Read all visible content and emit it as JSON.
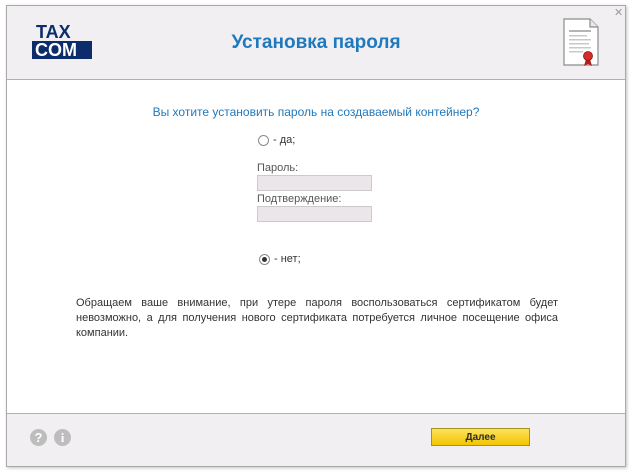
{
  "header": {
    "logo": {
      "line1": "TAX",
      "line2": "COM"
    },
    "title": "Установка пароля",
    "close_symbol": "✕"
  },
  "main": {
    "question": "Вы хотите установить пароль на создаваемый контейнер?",
    "option_yes": {
      "label": "- да;",
      "checked": false
    },
    "password": {
      "label": "Пароль:",
      "value": ""
    },
    "confirmation": {
      "label": "Подтверждение:",
      "value": ""
    },
    "option_no": {
      "label": "- нет;",
      "checked": true
    },
    "notice": "Обращаем ваше внимание, при утере пароля воспользоваться сертификатом будет невозможно, а для получения нового сертификата потребуется личное посещение офиса компании."
  },
  "footer": {
    "help_symbol": "?",
    "info_symbol": "i",
    "next_label": "Далее"
  },
  "colors": {
    "brand": "#0d2c6b",
    "accent": "#1e79be",
    "button": "#f2c500"
  },
  "icons": [
    "document-certificate-icon",
    "close-icon",
    "help-icon",
    "info-icon"
  ]
}
